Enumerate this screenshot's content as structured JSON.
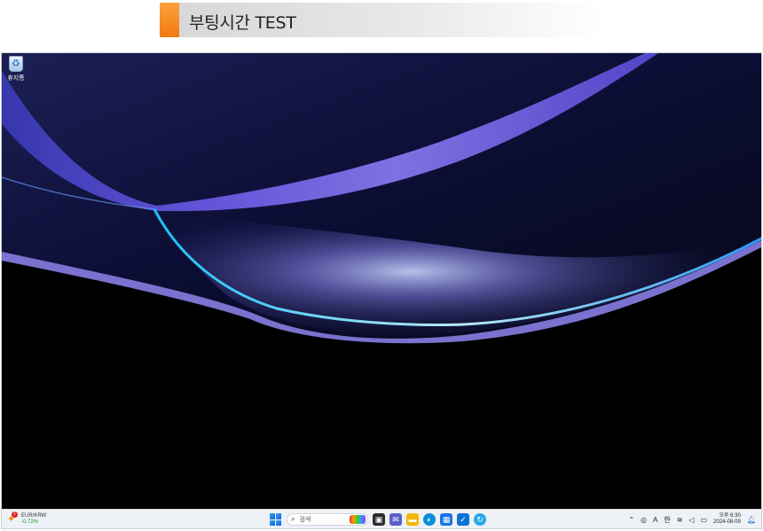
{
  "banner": {
    "title": "부팅시간 TEST",
    "accent_color": "#f07a10"
  },
  "desktop": {
    "icons": [
      {
        "label": "휴지통",
        "icon": "recycle-bin-icon"
      }
    ]
  },
  "taskbar": {
    "widget": {
      "name": "EUR/KRW",
      "change": "-0.72%",
      "badge": "1",
      "icon": "currency-widget-icon"
    },
    "search": {
      "placeholder": "검색",
      "icon": "search-icon"
    },
    "pinned_apps": [
      {
        "name": "task-view",
        "icon": "task-view-icon",
        "color": "#2b2b2b"
      },
      {
        "name": "teams-chat",
        "icon": "teams-icon",
        "color": "#5b5fc7"
      },
      {
        "name": "file-explorer",
        "icon": "folder-icon",
        "color": "#f3b700"
      },
      {
        "name": "edge",
        "icon": "edge-icon",
        "color": "#0b8fd8"
      },
      {
        "name": "store",
        "icon": "store-icon",
        "color": "#1a73e8"
      },
      {
        "name": "mail",
        "icon": "mail-icon",
        "color": "#0a74d6"
      },
      {
        "name": "app",
        "icon": "app-icon",
        "color": "#28a8e8"
      }
    ],
    "tray": {
      "ime_letter": "A",
      "ime_hangul": "한",
      "time": "오후 6:30",
      "date": "2024-08-09"
    }
  }
}
